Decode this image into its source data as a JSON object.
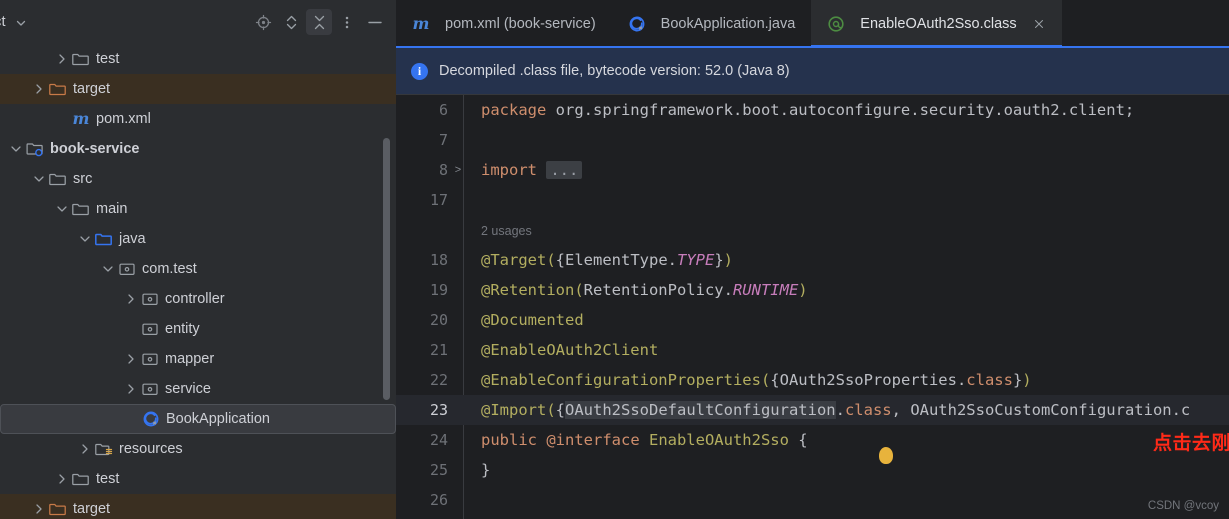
{
  "project_panel": {
    "title": "ect",
    "title_chevron_icon": "chevron-down-icon",
    "actions": [
      {
        "name": "locate-in-tree-icon",
        "label": "Select Opened File"
      },
      {
        "name": "expand-all-icon",
        "label": "Expand All"
      },
      {
        "name": "collapse-all-icon",
        "label": "Collapse All"
      },
      {
        "name": "more-options-icon",
        "label": "Options"
      },
      {
        "name": "hide-panel-icon",
        "label": "Hide"
      }
    ],
    "tree": [
      {
        "label": "test",
        "icon": "folder-icon",
        "indent": 2,
        "arrow": "collapsed",
        "state": "normal"
      },
      {
        "label": "target",
        "icon": "folder-excluded-icon",
        "indent": 1,
        "arrow": "collapsed",
        "state": "target-highlight"
      },
      {
        "label": "pom.xml",
        "icon": "maven-m-icon",
        "indent": 2,
        "arrow": "none",
        "state": "normal"
      },
      {
        "label": "book-service",
        "icon": "module-icon",
        "indent": 0,
        "arrow": "expanded",
        "state": "bold"
      },
      {
        "label": "src",
        "icon": "folder-icon",
        "indent": 1,
        "arrow": "expanded",
        "state": "normal"
      },
      {
        "label": "main",
        "icon": "folder-icon",
        "indent": 2,
        "arrow": "expanded",
        "state": "normal"
      },
      {
        "label": "java",
        "icon": "source-root-icon",
        "indent": 3,
        "arrow": "expanded",
        "state": "normal"
      },
      {
        "label": "com.test",
        "icon": "package-icon",
        "indent": 4,
        "arrow": "expanded",
        "state": "normal"
      },
      {
        "label": "controller",
        "icon": "package-icon",
        "indent": 5,
        "arrow": "collapsed",
        "state": "normal"
      },
      {
        "label": "entity",
        "icon": "package-icon",
        "indent": 5,
        "arrow": "none",
        "state": "normal"
      },
      {
        "label": "mapper",
        "icon": "package-icon",
        "indent": 5,
        "arrow": "collapsed",
        "state": "normal"
      },
      {
        "label": "service",
        "icon": "package-icon",
        "indent": 5,
        "arrow": "collapsed",
        "state": "normal"
      },
      {
        "label": "BookApplication",
        "icon": "spring-class-icon",
        "indent": 5,
        "arrow": "none",
        "state": "selected"
      },
      {
        "label": "resources",
        "icon": "resources-root-icon",
        "indent": 3,
        "arrow": "collapsed",
        "state": "normal"
      },
      {
        "label": "test",
        "icon": "folder-icon",
        "indent": 2,
        "arrow": "collapsed",
        "state": "normal"
      },
      {
        "label": "target",
        "icon": "folder-excluded-icon",
        "indent": 1,
        "arrow": "collapsed",
        "state": "target-highlight"
      }
    ]
  },
  "editor": {
    "tabs": [
      {
        "label": "pom.xml (book-service)",
        "icon": "maven-m-icon",
        "active": false,
        "closable": false
      },
      {
        "label": "BookApplication.java",
        "icon": "spring-class-icon",
        "active": false,
        "closable": false
      },
      {
        "label": "EnableOAuth2Sso.class",
        "icon": "annotation-at-icon",
        "active": true,
        "closable": true,
        "close_icon": "close-icon"
      }
    ],
    "notification": {
      "icon": "info-icon",
      "icon_glyph": "i",
      "text": "Decompiled .class file, bytecode version: 52.0 (Java 8)"
    },
    "usages_hint": "2 usages",
    "current_line": 23,
    "lines": [
      {
        "num": "6",
        "fold": "",
        "segments": [
          {
            "t": "package ",
            "c": "kw"
          },
          {
            "t": "org.springframework.boot.autoconfigure.security.oauth2.client;",
            "c": "ident"
          }
        ]
      },
      {
        "num": "7",
        "fold": "",
        "segments": []
      },
      {
        "num": "8",
        "fold": ">",
        "segments": [
          {
            "t": "import ",
            "c": "kw"
          },
          {
            "t": "...",
            "c": "import-fold"
          }
        ]
      },
      {
        "num": "17",
        "fold": "",
        "segments": []
      },
      {
        "num": "",
        "fold": "",
        "hint": "2 usages",
        "segments": []
      },
      {
        "num": "18",
        "fold": "",
        "segments": [
          {
            "t": "@Target(",
            "c": "ann"
          },
          {
            "t": "{",
            "c": "punc"
          },
          {
            "t": "ElementType.",
            "c": "ident"
          },
          {
            "t": "TYPE",
            "c": "stat"
          },
          {
            "t": "}",
            "c": "punc"
          },
          {
            "t": ")",
            "c": "ann"
          }
        ]
      },
      {
        "num": "19",
        "fold": "",
        "segments": [
          {
            "t": "@Retention(",
            "c": "ann"
          },
          {
            "t": "RetentionPolicy.",
            "c": "ident"
          },
          {
            "t": "RUNTIME",
            "c": "stat"
          },
          {
            "t": ")",
            "c": "ann"
          }
        ]
      },
      {
        "num": "20",
        "fold": "",
        "segments": [
          {
            "t": "@Documented",
            "c": "ann"
          }
        ]
      },
      {
        "num": "21",
        "fold": "",
        "segments": [
          {
            "t": "@EnableOAuth2Client",
            "c": "ann"
          }
        ]
      },
      {
        "num": "22",
        "fold": "",
        "segments": [
          {
            "t": "@EnableConfigurationProperties(",
            "c": "ann"
          },
          {
            "t": "{",
            "c": "punc"
          },
          {
            "t": "OAuth2SsoProperties.",
            "c": "ident"
          },
          {
            "t": "class",
            "c": "kw"
          },
          {
            "t": "}",
            "c": "punc"
          },
          {
            "t": ")",
            "c": "ann"
          }
        ]
      },
      {
        "num": "23",
        "fold": "",
        "current": true,
        "segments": [
          {
            "t": "@Import(",
            "c": "ann"
          },
          {
            "t": "{",
            "c": "punc"
          },
          {
            "t": "OAuth2SsoDefaultConfiguration",
            "c": "ident sel-ident"
          },
          {
            "t": ".",
            "c": "ident"
          },
          {
            "t": "class",
            "c": "kw"
          },
          {
            "t": ", ",
            "c": "ident"
          },
          {
            "t": "OAuth2SsoCustomConfiguration.c",
            "c": "ident"
          }
        ]
      },
      {
        "num": "24",
        "fold": "",
        "segments": [
          {
            "t": "public ",
            "c": "kw"
          },
          {
            "t": "@interface ",
            "c": "kw"
          },
          {
            "t": "EnableOAuth2Sso ",
            "c": "ifacename"
          },
          {
            "t": "{",
            "c": "punc"
          }
        ]
      },
      {
        "num": "25",
        "fold": "",
        "segments": [
          {
            "t": "}",
            "c": "punc"
          }
        ]
      },
      {
        "num": "26",
        "fold": "",
        "segments": []
      }
    ],
    "annotation_cn": "点击去刚添加的注解",
    "annotation_color": "#ff2a18",
    "cursor_marker": "caret-highlight"
  },
  "watermark": "CSDN @vcoy",
  "colors": {
    "accent": "#3574f0",
    "panel_bg": "#2b2d30",
    "editor_bg": "#1e1f22",
    "notification_bg": "#25324d",
    "target_row": "#3a2f21",
    "annotation_red": "#ff2a18"
  }
}
